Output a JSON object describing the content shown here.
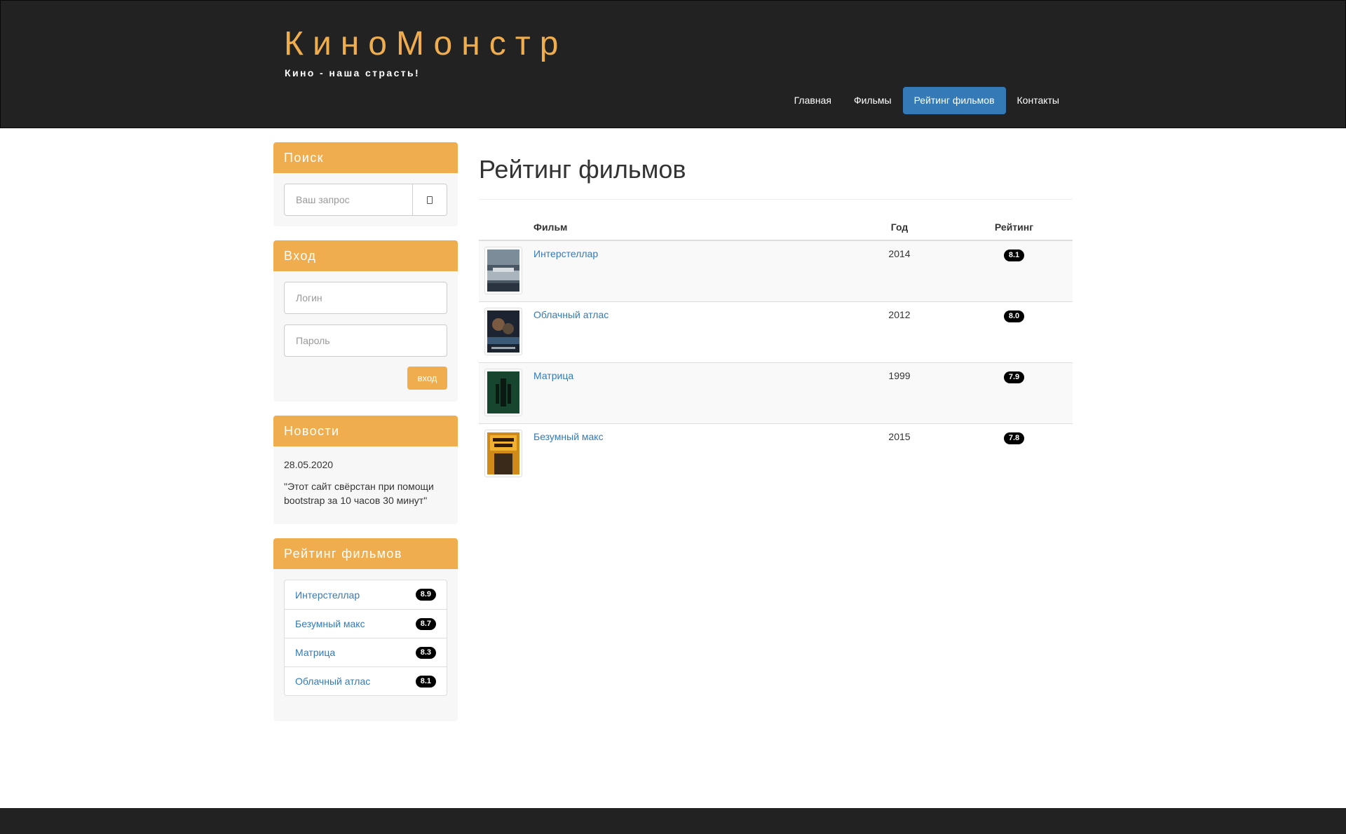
{
  "brand": {
    "title": "КиноМонстр",
    "tagline": "Кино - наша страсть!"
  },
  "nav": {
    "items": [
      {
        "label": "Главная"
      },
      {
        "label": "Фильмы"
      },
      {
        "label": "Рейтинг фильмов"
      },
      {
        "label": "Контакты"
      }
    ],
    "active": "Рейтинг фильмов"
  },
  "sidebar": {
    "search": {
      "title": "Поиск",
      "placeholder": "Ваш запрос",
      "icon": "search-icon"
    },
    "login": {
      "title": "Вход",
      "login_placeholder": "Логин",
      "password_placeholder": "Пароль",
      "button": "вход"
    },
    "news": {
      "title": "Новости",
      "date": "28.05.2020",
      "text": "\"Этот сайт свёрстан при помощи bootstrap за 10 часов 30 минут\""
    },
    "rating": {
      "title": "Рейтинг фильмов",
      "items": [
        {
          "name": "Интерстеллар",
          "score": "8.9"
        },
        {
          "name": "Безумный макс",
          "score": "8.7"
        },
        {
          "name": "Матрица",
          "score": "8.3"
        },
        {
          "name": "Облачный атлас",
          "score": "8.1"
        }
      ]
    }
  },
  "main": {
    "title": "Рейтинг фильмов",
    "columns": {
      "film": "Фильм",
      "year": "Год",
      "rating": "Рейтинг"
    },
    "rows": [
      {
        "film": "Интерстеллар",
        "year": "2014",
        "rating": "8.1"
      },
      {
        "film": "Облачный атлас",
        "year": "2012",
        "rating": "8.0"
      },
      {
        "film": "Матрица",
        "year": "1999",
        "rating": "7.9"
      },
      {
        "film": "Безумный макс",
        "year": "2015",
        "rating": "7.8"
      }
    ]
  },
  "colors": {
    "accent": "#f0ad4e",
    "header_bg": "#222222",
    "nav_active": "#337ab7",
    "link": "#337ab7",
    "badge": "#000000"
  }
}
